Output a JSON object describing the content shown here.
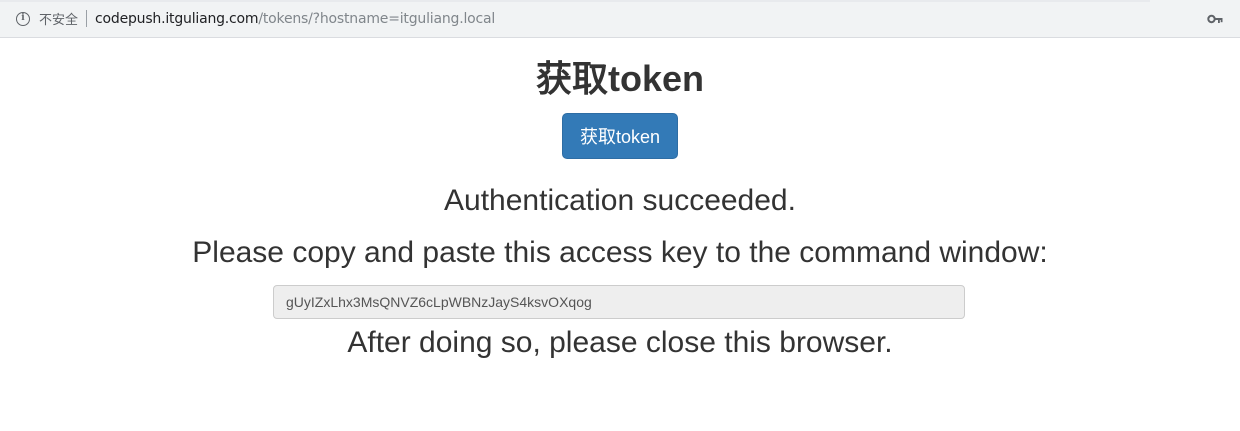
{
  "browser": {
    "security_label": "不安全",
    "url_host": "codepush.itguliang.com",
    "url_path": "/tokens/?hostname=itguliang.local",
    "info_icon": "info-icon",
    "key_icon": "key-icon"
  },
  "page": {
    "title": "获取token",
    "button_label": "获取token",
    "auth_message": "Authentication succeeded.",
    "copy_message": "Please copy and paste this access key to the command window:",
    "access_key": "gUyIZxLhx3MsQNVZ6cLpWBNzJayS4ksvOXqog",
    "close_message": "After doing so, please close this browser."
  },
  "colors": {
    "button_bg": "#337ab7",
    "text": "#333333",
    "input_bg": "#eeeeee"
  }
}
